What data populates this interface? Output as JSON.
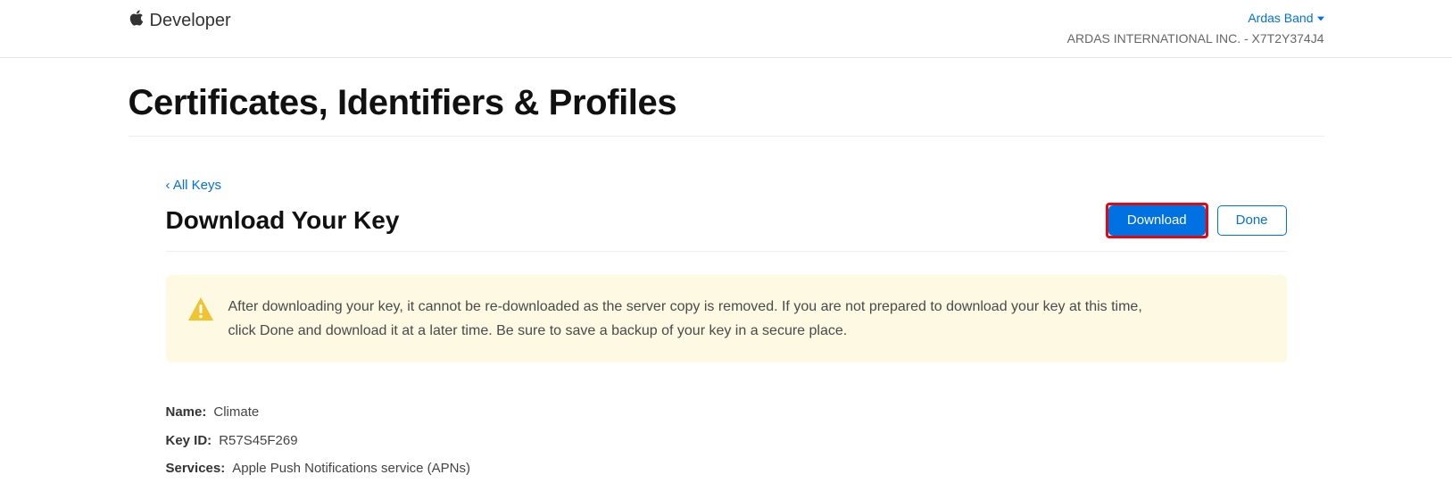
{
  "header": {
    "brand": "Developer",
    "userName": "Ardas Band",
    "teamLine": "ARDAS INTERNATIONAL INC. - X7T2Y374J4"
  },
  "page": {
    "title": "Certificates, Identifiers & Profiles",
    "backLabel": "‹ All Keys",
    "subTitle": "Download Your Key",
    "buttons": {
      "download": "Download",
      "done": "Done"
    },
    "alert": "After downloading your key, it cannot be re-downloaded as the server copy is removed. If you are not prepared to download your key at this time, click Done and download it at a later time. Be sure to save a backup of your key in a secure place.",
    "details": {
      "nameLabel": "Name:",
      "nameValue": "Climate",
      "keyIdLabel": "Key ID:",
      "keyIdValue": "R57S45F269",
      "servicesLabel": "Services:",
      "servicesValue": "Apple Push Notifications service (APNs)"
    }
  }
}
